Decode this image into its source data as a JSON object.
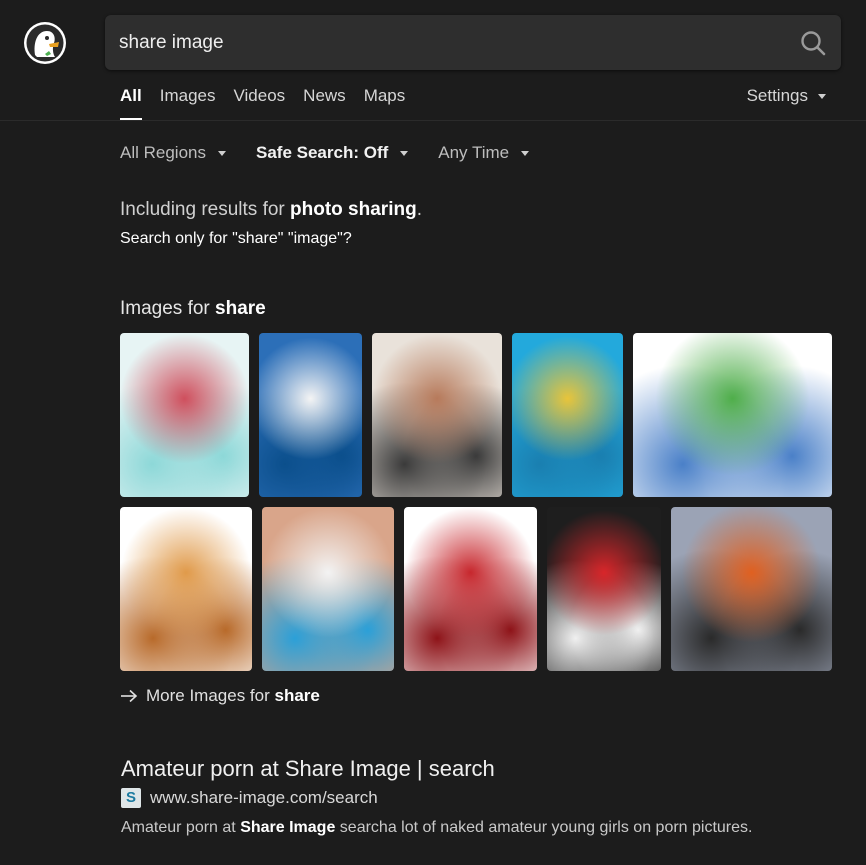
{
  "search": {
    "query": "share image",
    "button_icon": "search-icon"
  },
  "nav": {
    "tabs": [
      {
        "label": "All",
        "active": true
      },
      {
        "label": "Images",
        "active": false
      },
      {
        "label": "Videos",
        "active": false
      },
      {
        "label": "News",
        "active": false
      },
      {
        "label": "Maps",
        "active": false
      }
    ],
    "settings_label": "Settings"
  },
  "filters": {
    "region": "All Regions",
    "safe_search": "Safe Search: Off",
    "time": "Any Time"
  },
  "spelling": {
    "including_prefix": "Including results for",
    "including_term": "photo sharing",
    "including_suffix": ".",
    "search_only_prefix": "Search only for",
    "search_only_terms": "\"share\" \"image\"",
    "search_only_suffix": "?"
  },
  "images_module": {
    "heading_prefix": "Images for",
    "heading_term": "share",
    "more_prefix": "More Images for",
    "more_term": "share",
    "thumbnails": [
      {
        "colors": [
          "#e7f4f4",
          "#cf4f5d",
          "#8dd8d8"
        ]
      },
      {
        "colors": [
          "#2c6fb8",
          "#f4f4f4",
          "#0b4f8c"
        ]
      },
      {
        "colors": [
          "#e9e2da",
          "#b77a5b",
          "#3a3a3a"
        ]
      },
      {
        "colors": [
          "#23a9dc",
          "#e8c43a",
          "#1a7fb0"
        ]
      },
      {
        "colors": [
          "#ffffff",
          "#4fae4a",
          "#4a80c8"
        ]
      },
      {
        "colors": [
          "#ffffff",
          "#e09a4a",
          "#b86a2a"
        ]
      },
      {
        "colors": [
          "#d9a58a",
          "#f3f3f3",
          "#2ba0d8"
        ]
      },
      {
        "colors": [
          "#ffffff",
          "#c7272d",
          "#8e1318"
        ]
      },
      {
        "colors": [
          "#1e1e1e",
          "#d8262a",
          "#f0f0f0"
        ]
      },
      {
        "colors": [
          "#9ba3b5",
          "#e06020",
          "#2a2a2a"
        ]
      }
    ]
  },
  "result": {
    "title": "Amateur porn at Share Image | search",
    "favicon_letter": "S",
    "url": "www.share-image.com/search",
    "snippet_prefix": "Amateur porn at",
    "snippet_bold": "Share Image",
    "snippet_suffix": "searcha lot of naked amateur young girls on porn pictures."
  }
}
